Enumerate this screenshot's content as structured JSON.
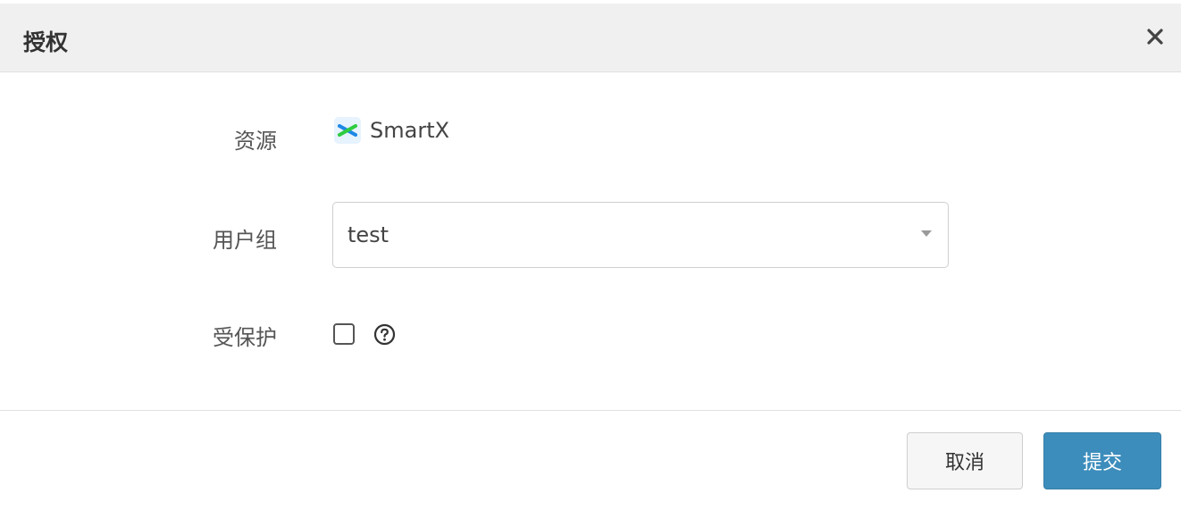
{
  "dialog": {
    "title": "授权",
    "close_icon": "close-icon"
  },
  "form": {
    "resource": {
      "label": "资源",
      "icon": "smartx-logo-icon",
      "value": "SmartX"
    },
    "user_group": {
      "label": "用户组",
      "value": "test",
      "dropdown_icon": "caret-down-icon"
    },
    "protected": {
      "label": "受保护",
      "checked": false,
      "help_icon": "help-circle-icon"
    }
  },
  "footer": {
    "cancel_label": "取消",
    "submit_label": "提交"
  },
  "colors": {
    "header_bg": "#f0f0f0",
    "primary": "#3c8dbc",
    "logo_blue": "#1e88e5",
    "logo_green": "#2ecc40"
  }
}
